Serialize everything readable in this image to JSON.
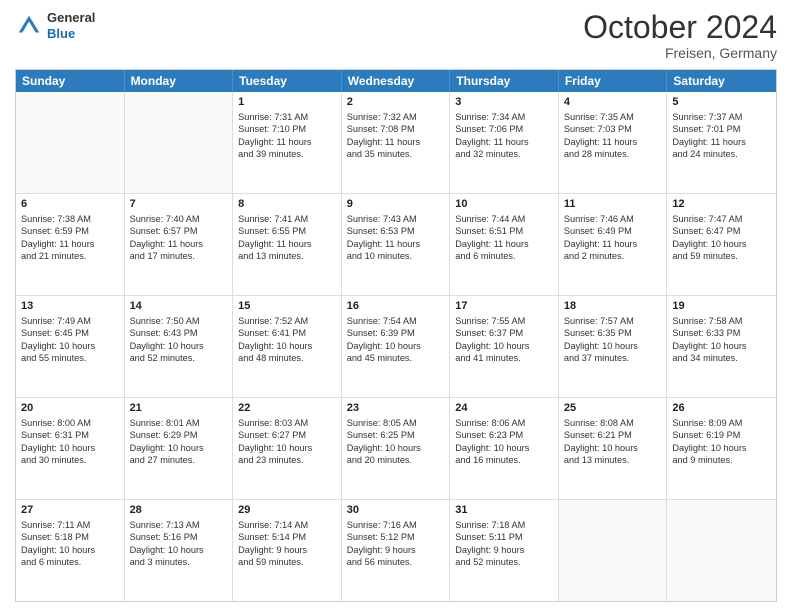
{
  "logo": {
    "line1": "General",
    "line2": "Blue"
  },
  "title": "October 2024",
  "location": "Freisen, Germany",
  "days_of_week": [
    "Sunday",
    "Monday",
    "Tuesday",
    "Wednesday",
    "Thursday",
    "Friday",
    "Saturday"
  ],
  "rows": [
    [
      {
        "day": "",
        "text": ""
      },
      {
        "day": "",
        "text": ""
      },
      {
        "day": "1",
        "text": "Sunrise: 7:31 AM\nSunset: 7:10 PM\nDaylight: 11 hours\nand 39 minutes."
      },
      {
        "day": "2",
        "text": "Sunrise: 7:32 AM\nSunset: 7:08 PM\nDaylight: 11 hours\nand 35 minutes."
      },
      {
        "day": "3",
        "text": "Sunrise: 7:34 AM\nSunset: 7:06 PM\nDaylight: 11 hours\nand 32 minutes."
      },
      {
        "day": "4",
        "text": "Sunrise: 7:35 AM\nSunset: 7:03 PM\nDaylight: 11 hours\nand 28 minutes."
      },
      {
        "day": "5",
        "text": "Sunrise: 7:37 AM\nSunset: 7:01 PM\nDaylight: 11 hours\nand 24 minutes."
      }
    ],
    [
      {
        "day": "6",
        "text": "Sunrise: 7:38 AM\nSunset: 6:59 PM\nDaylight: 11 hours\nand 21 minutes."
      },
      {
        "day": "7",
        "text": "Sunrise: 7:40 AM\nSunset: 6:57 PM\nDaylight: 11 hours\nand 17 minutes."
      },
      {
        "day": "8",
        "text": "Sunrise: 7:41 AM\nSunset: 6:55 PM\nDaylight: 11 hours\nand 13 minutes."
      },
      {
        "day": "9",
        "text": "Sunrise: 7:43 AM\nSunset: 6:53 PM\nDaylight: 11 hours\nand 10 minutes."
      },
      {
        "day": "10",
        "text": "Sunrise: 7:44 AM\nSunset: 6:51 PM\nDaylight: 11 hours\nand 6 minutes."
      },
      {
        "day": "11",
        "text": "Sunrise: 7:46 AM\nSunset: 6:49 PM\nDaylight: 11 hours\nand 2 minutes."
      },
      {
        "day": "12",
        "text": "Sunrise: 7:47 AM\nSunset: 6:47 PM\nDaylight: 10 hours\nand 59 minutes."
      }
    ],
    [
      {
        "day": "13",
        "text": "Sunrise: 7:49 AM\nSunset: 6:45 PM\nDaylight: 10 hours\nand 55 minutes."
      },
      {
        "day": "14",
        "text": "Sunrise: 7:50 AM\nSunset: 6:43 PM\nDaylight: 10 hours\nand 52 minutes."
      },
      {
        "day": "15",
        "text": "Sunrise: 7:52 AM\nSunset: 6:41 PM\nDaylight: 10 hours\nand 48 minutes."
      },
      {
        "day": "16",
        "text": "Sunrise: 7:54 AM\nSunset: 6:39 PM\nDaylight: 10 hours\nand 45 minutes."
      },
      {
        "day": "17",
        "text": "Sunrise: 7:55 AM\nSunset: 6:37 PM\nDaylight: 10 hours\nand 41 minutes."
      },
      {
        "day": "18",
        "text": "Sunrise: 7:57 AM\nSunset: 6:35 PM\nDaylight: 10 hours\nand 37 minutes."
      },
      {
        "day": "19",
        "text": "Sunrise: 7:58 AM\nSunset: 6:33 PM\nDaylight: 10 hours\nand 34 minutes."
      }
    ],
    [
      {
        "day": "20",
        "text": "Sunrise: 8:00 AM\nSunset: 6:31 PM\nDaylight: 10 hours\nand 30 minutes."
      },
      {
        "day": "21",
        "text": "Sunrise: 8:01 AM\nSunset: 6:29 PM\nDaylight: 10 hours\nand 27 minutes."
      },
      {
        "day": "22",
        "text": "Sunrise: 8:03 AM\nSunset: 6:27 PM\nDaylight: 10 hours\nand 23 minutes."
      },
      {
        "day": "23",
        "text": "Sunrise: 8:05 AM\nSunset: 6:25 PM\nDaylight: 10 hours\nand 20 minutes."
      },
      {
        "day": "24",
        "text": "Sunrise: 8:06 AM\nSunset: 6:23 PM\nDaylight: 10 hours\nand 16 minutes."
      },
      {
        "day": "25",
        "text": "Sunrise: 8:08 AM\nSunset: 6:21 PM\nDaylight: 10 hours\nand 13 minutes."
      },
      {
        "day": "26",
        "text": "Sunrise: 8:09 AM\nSunset: 6:19 PM\nDaylight: 10 hours\nand 9 minutes."
      }
    ],
    [
      {
        "day": "27",
        "text": "Sunrise: 7:11 AM\nSunset: 5:18 PM\nDaylight: 10 hours\nand 6 minutes."
      },
      {
        "day": "28",
        "text": "Sunrise: 7:13 AM\nSunset: 5:16 PM\nDaylight: 10 hours\nand 3 minutes."
      },
      {
        "day": "29",
        "text": "Sunrise: 7:14 AM\nSunset: 5:14 PM\nDaylight: 9 hours\nand 59 minutes."
      },
      {
        "day": "30",
        "text": "Sunrise: 7:16 AM\nSunset: 5:12 PM\nDaylight: 9 hours\nand 56 minutes."
      },
      {
        "day": "31",
        "text": "Sunrise: 7:18 AM\nSunset: 5:11 PM\nDaylight: 9 hours\nand 52 minutes."
      },
      {
        "day": "",
        "text": ""
      },
      {
        "day": "",
        "text": ""
      }
    ]
  ]
}
